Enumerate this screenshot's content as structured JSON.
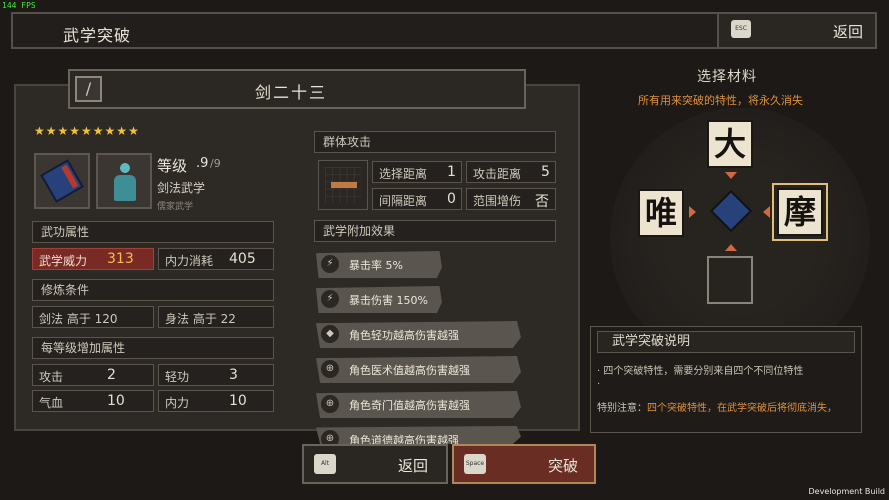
{
  "overlay": {
    "fps": "144 FPS",
    "dev_build": "Development Build"
  },
  "header": {
    "title": "武学突破",
    "back_key": "ESC",
    "back_label": "返回"
  },
  "skill": {
    "name": "剑二十三",
    "stars": "★★★★★★★★★",
    "level_label": "等级",
    "level_value": ".9",
    "level_max": "/9",
    "type": "剑法武学",
    "sect": "儒家武学"
  },
  "sections": {
    "attributes": "武功属性",
    "requirements": "修炼条件",
    "per_level": "每等级增加属性",
    "group_attack": "群体攻击",
    "extra_effects": "武学附加效果"
  },
  "attributes": [
    {
      "label": "武学威力",
      "value": "313"
    },
    {
      "label": "内力消耗",
      "value": "405"
    }
  ],
  "requirements": [
    {
      "label": "剑法 高于 120"
    },
    {
      "label": "身法 高于 22"
    }
  ],
  "per_level": [
    {
      "label": "攻击",
      "value": "2"
    },
    {
      "label": "轻功",
      "value": "3"
    },
    {
      "label": "气血",
      "value": "10"
    },
    {
      "label": "内力",
      "value": "10"
    }
  ],
  "range_stats": [
    {
      "label": "选择距离",
      "value": "1"
    },
    {
      "label": "攻击距离",
      "value": "5"
    },
    {
      "label": "间隔距离",
      "value": "0"
    },
    {
      "label": "范围增伤",
      "value": "否"
    }
  ],
  "effects": [
    {
      "icon": "⚡",
      "text": "暴击率 5%"
    },
    {
      "icon": "⚡",
      "text": "暴击伤害 150%"
    },
    {
      "icon": "◆",
      "text": "角色轻功越高伤害越强"
    },
    {
      "icon": "⊕",
      "text": "角色医术值越高伤害越强"
    },
    {
      "icon": "⊕",
      "text": "角色奇门值越高伤害越强"
    },
    {
      "icon": "⊕",
      "text": "角色道德越高伤害越强"
    }
  ],
  "materials": {
    "title": "选择材料",
    "note": "所有用来突破的特性，将永久消失",
    "top": "大",
    "left": "唯",
    "right": "摩",
    "bottom": ""
  },
  "description": {
    "title": "武学突破说明",
    "line1": "· 四个突破特性，需要分别来自四个不同位特性",
    "line2": "·",
    "line3_prefix": "特别注意：",
    "line3_warn": "四个突破特性，在武学突破后将彻底消失，"
  },
  "buttons": {
    "back_key": "Alt",
    "back_label": "返回",
    "break_key": "Space",
    "break_label": "突破"
  },
  "colors": {
    "accent": "#e0913a",
    "highlight_value": "#f2c046",
    "stars": "#f0c23a"
  }
}
